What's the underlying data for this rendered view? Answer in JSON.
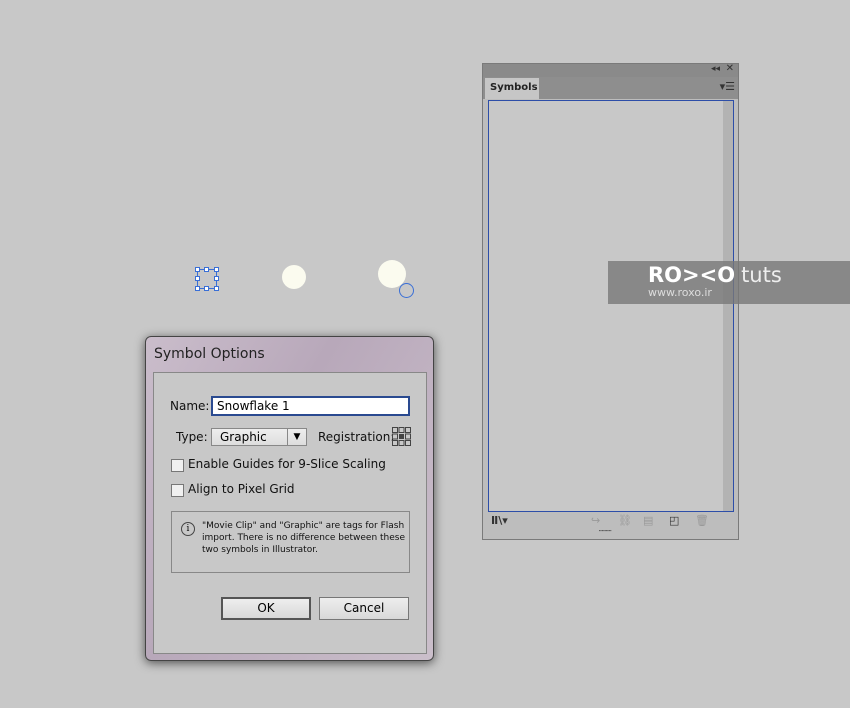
{
  "canvas": {
    "object_fill": "#fbfbef",
    "selection_color": "#3a6fd6"
  },
  "symbols_panel": {
    "tab_label": "Symbols",
    "collapse_icon": "double-chevron-left-icon",
    "close_icon": "close-icon",
    "menu_icon": "panel-menu-icon",
    "footer_icons": [
      "symbol-libraries-icon",
      "place-symbol-icon",
      "break-link-icon",
      "symbol-options-icon",
      "new-symbol-icon",
      "delete-icon"
    ]
  },
  "watermark": {
    "logo": "RO><O",
    "suffix": "tuts",
    "url": "www.roxo.ir"
  },
  "dialog": {
    "title": "Symbol Options",
    "name_label": "Name:",
    "name_value": "Snowflake 1",
    "type_label": "Type:",
    "type_value": "Graphic",
    "registration_label": "Registration:",
    "checkbox_9slice": "Enable Guides for 9-Slice Scaling",
    "checkbox_9slice_checked": false,
    "checkbox_pixel": "Align to Pixel Grid",
    "checkbox_pixel_checked": false,
    "info": "\"Movie Clip\" and \"Graphic\" are tags for Flash import. There is no difference between these two symbols in Illustrator.",
    "ok": "OK",
    "cancel": "Cancel"
  }
}
